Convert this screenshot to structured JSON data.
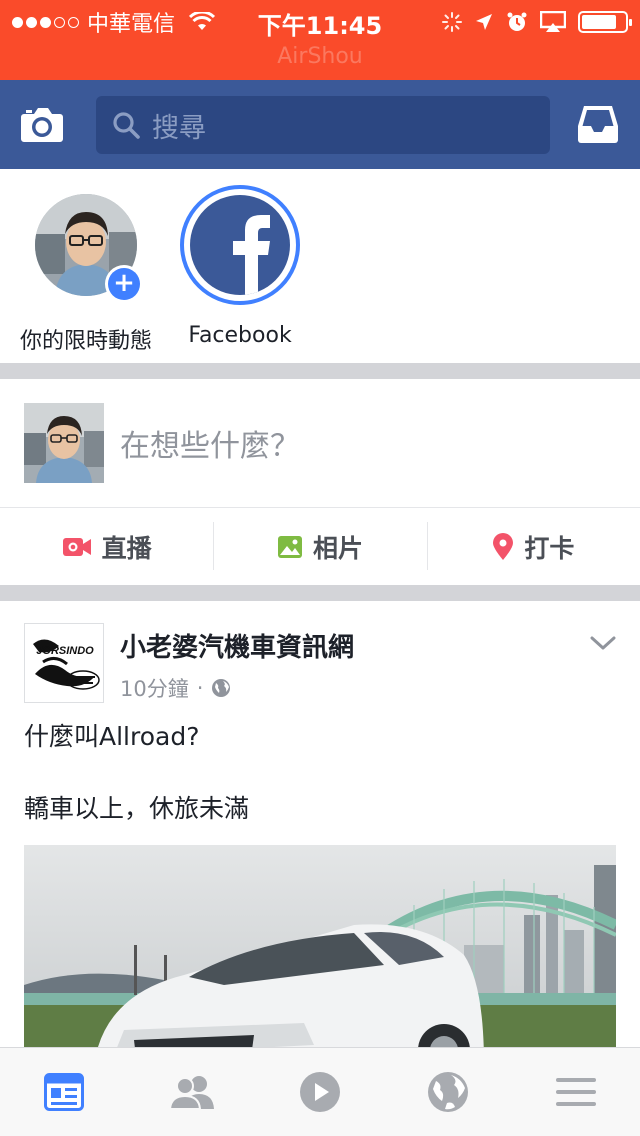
{
  "status_bar": {
    "carrier": "中華電信",
    "time": "下午11:45",
    "watermark": "AirShou",
    "signal_bars": 3,
    "battery_level": 0.82
  },
  "nav": {
    "search_placeholder": "搜尋",
    "icons": [
      "camera-icon",
      "search-icon",
      "inbox-icon"
    ]
  },
  "stories": [
    {
      "label": "你的限時動態"
    },
    {
      "label": "Facebook"
    }
  ],
  "composer": {
    "placeholder": "在想些什麼？"
  },
  "actions": [
    {
      "label": "直播",
      "icon": "live-video-icon",
      "color": "#f35369"
    },
    {
      "label": "相片",
      "icon": "photo-icon",
      "color": "#7fbb42"
    },
    {
      "label": "打卡",
      "icon": "checkin-icon",
      "color": "#f35369"
    }
  ],
  "post": {
    "author": "小老婆汽機車資訊網",
    "time": "10分鐘",
    "separator": "·",
    "privacy_icon": "globe-icon",
    "logo_text": "JORSINDO",
    "line1": "什麼叫Allroad?",
    "line2": "轎車以上，休旅未滿"
  },
  "tabbar": {
    "items": [
      "news-feed-icon",
      "friends-icon",
      "video-icon",
      "notifications-globe-icon",
      "menu-icon"
    ],
    "active": 0
  },
  "colors": {
    "status_bar": "#fa4b2a",
    "nav_bar": "#3b5998",
    "accent": "#4080ff",
    "separator": "#d3d4d8"
  }
}
